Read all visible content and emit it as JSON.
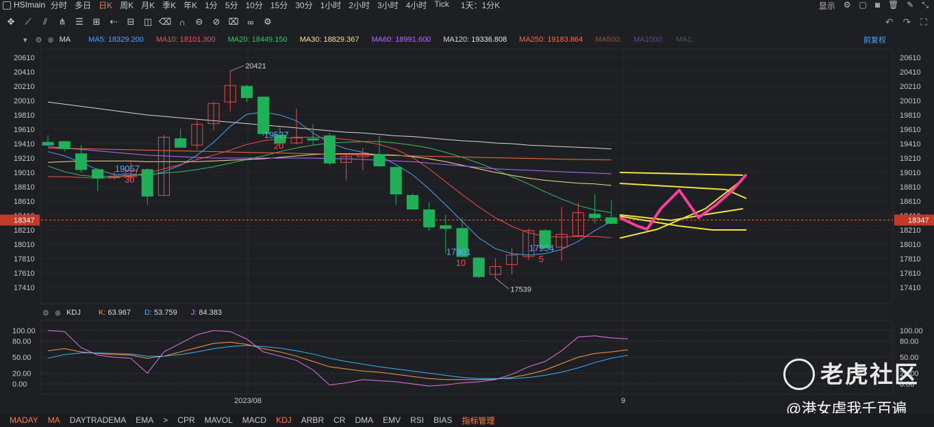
{
  "topbar": {
    "symbol": "HSImain",
    "timeframes": [
      {
        "label": "分时",
        "active": false
      },
      {
        "label": "多日",
        "active": false
      },
      {
        "label": "日K",
        "active": true
      },
      {
        "label": "周K",
        "active": false
      },
      {
        "label": "月K",
        "active": false
      },
      {
        "label": "季K",
        "active": false
      },
      {
        "label": "年K",
        "active": false
      },
      {
        "label": "1分",
        "active": false
      },
      {
        "label": "5分",
        "active": false
      },
      {
        "label": "10分",
        "active": false
      },
      {
        "label": "15分",
        "active": false
      },
      {
        "label": "30分",
        "active": false
      },
      {
        "label": "1小时",
        "active": false
      },
      {
        "label": "2小时",
        "active": false
      },
      {
        "label": "3小时",
        "active": false
      },
      {
        "label": "4小时",
        "active": false
      },
      {
        "label": "Tick",
        "active": false
      }
    ],
    "interval_select": "1天：1分K",
    "display_label": "显示"
  },
  "ma_row": {
    "indicator": "MA",
    "items": [
      {
        "label": "MA5:",
        "value": "18329.200",
        "color": "#4aa3ff"
      },
      {
        "label": "MA10:",
        "value": "18101.300",
        "color": "#ff4d4f"
      },
      {
        "label": "MA20:",
        "value": "18449.150",
        "color": "#3cbf6a"
      },
      {
        "label": "MA30:",
        "value": "18829.367",
        "color": "#f5e28a"
      },
      {
        "label": "MA60:",
        "value": "18991.600",
        "color": "#b070ff"
      },
      {
        "label": "MA120:",
        "value": "19336.808",
        "color": "#d9d9d9"
      },
      {
        "label": "MA250:",
        "value": "19183.864",
        "color": "#ff6a3d"
      },
      {
        "label": "MA500:",
        "value": "",
        "color": "#8a5a3a"
      },
      {
        "label": "MA1000:",
        "value": "",
        "color": "#5a4a8a"
      },
      {
        "label": "MA1:",
        "value": "",
        "color": "#555555"
      }
    ],
    "adjust_label": "前复权"
  },
  "kdj_row": {
    "indicator": "KDJ",
    "items": [
      {
        "label": "K:",
        "value": "63.967",
        "color": "#ff9a3c"
      },
      {
        "label": "D:",
        "value": "53.759",
        "color": "#38b6ff"
      },
      {
        "label": "J:",
        "value": "84.383",
        "color": "#e27ae6"
      }
    ]
  },
  "bottom_tabs": [
    {
      "label": "MADAY",
      "active": true
    },
    {
      "label": "MA",
      "active": true
    },
    {
      "label": "DAYTRADEMA",
      "active": false
    },
    {
      "label": "EMA",
      "active": false
    },
    {
      "label": ">",
      "active": false
    },
    {
      "label": "CPR",
      "active": false
    },
    {
      "label": "MAVOL",
      "active": false
    },
    {
      "label": "MACD",
      "active": false
    },
    {
      "label": "KDJ",
      "active": true
    },
    {
      "label": "ARBR",
      "active": false
    },
    {
      "label": "CR",
      "active": false
    },
    {
      "label": "DMA",
      "active": false
    },
    {
      "label": "EMV",
      "active": false
    },
    {
      "label": "RSI",
      "active": false
    },
    {
      "label": "BIAS",
      "active": false
    },
    {
      "label": "指标管理",
      "active": true
    }
  ],
  "watermark": {
    "brand": "老虎社区",
    "user": "@港女虐我千百遍"
  },
  "chart_data": {
    "type": "candlestick",
    "price_axis_ticks": [
      "20610",
      "20410",
      "20210",
      "20010",
      "19810",
      "19610",
      "19410",
      "19210",
      "19010",
      "18810",
      "18610",
      "18410",
      "18210",
      "18010",
      "17810",
      "17610",
      "17410"
    ],
    "last_price_label": "18347",
    "x_labels": [
      {
        "index": 12,
        "label": "2023/08"
      },
      {
        "index": 35,
        "label": "9"
      }
    ],
    "ohlc": [
      {
        "o": 19430,
        "h": 19530,
        "l": 19380,
        "c": 19390
      },
      {
        "o": 19440,
        "h": 19450,
        "l": 19300,
        "c": 19340
      },
      {
        "o": 19270,
        "h": 19390,
        "l": 19010,
        "c": 19050
      },
      {
        "o": 19050,
        "h": 19070,
        "l": 18750,
        "c": 18930
      },
      {
        "o": 18940,
        "h": 19020,
        "l": 18910,
        "c": 18950
      },
      {
        "o": 18950,
        "h": 19180,
        "l": 18900,
        "c": 19040
      },
      {
        "o": 19050,
        "h": 19070,
        "l": 18560,
        "c": 18680
      },
      {
        "o": 18690,
        "h": 19530,
        "l": 18680,
        "c": 19500
      },
      {
        "o": 19480,
        "h": 19620,
        "l": 19360,
        "c": 19360
      },
      {
        "o": 19390,
        "h": 19760,
        "l": 19330,
        "c": 19680
      },
      {
        "o": 19690,
        "h": 19990,
        "l": 19600,
        "c": 19970
      },
      {
        "o": 19990,
        "h": 20421,
        "l": 19860,
        "c": 20220
      },
      {
        "o": 20210,
        "h": 20230,
        "l": 19990,
        "c": 20050
      },
      {
        "o": 20060,
        "h": 20060,
        "l": 19520,
        "c": 19550
      },
      {
        "o": 19530,
        "h": 19640,
        "l": 19390,
        "c": 19420
      },
      {
        "o": 19420,
        "h": 19900,
        "l": 19400,
        "c": 19490
      },
      {
        "o": 19480,
        "h": 19680,
        "l": 19390,
        "c": 19460
      },
      {
        "o": 19520,
        "h": 19560,
        "l": 19110,
        "c": 19140
      },
      {
        "o": 19150,
        "h": 19260,
        "l": 18900,
        "c": 19230
      },
      {
        "o": 19230,
        "h": 19350,
        "l": 19040,
        "c": 19260
      },
      {
        "o": 19260,
        "h": 19520,
        "l": 19090,
        "c": 19100
      },
      {
        "o": 19080,
        "h": 19100,
        "l": 18560,
        "c": 18710
      },
      {
        "o": 18690,
        "h": 18720,
        "l": 18490,
        "c": 18500
      },
      {
        "o": 18490,
        "h": 18590,
        "l": 18200,
        "c": 18250
      },
      {
        "o": 18270,
        "h": 18420,
        "l": 17880,
        "c": 18230
      },
      {
        "o": 18230,
        "h": 18380,
        "l": 17830,
        "c": 17840
      },
      {
        "o": 17820,
        "h": 17830,
        "l": 17540,
        "c": 17560
      },
      {
        "o": 17590,
        "h": 17820,
        "l": 17539,
        "c": 17700
      },
      {
        "o": 17730,
        "h": 17960,
        "l": 17590,
        "c": 17860
      },
      {
        "o": 17840,
        "h": 18230,
        "l": 17790,
        "c": 18200
      },
      {
        "o": 18200,
        "h": 18220,
        "l": 17940,
        "c": 17960
      },
      {
        "o": 17970,
        "h": 18530,
        "l": 17780,
        "c": 18150
      },
      {
        "o": 18130,
        "h": 18590,
        "l": 18120,
        "c": 18450
      },
      {
        "o": 18430,
        "h": 18710,
        "l": 18300,
        "c": 18380
      },
      {
        "o": 18380,
        "h": 18620,
        "l": 18290,
        "c": 18300
      }
    ],
    "ma_lines": [
      {
        "name": "MA5",
        "color": "#4aa3ff",
        "values": [
          19300,
          19240,
          19150,
          19050,
          18980,
          18990,
          18960,
          19020,
          19110,
          19250,
          19430,
          19650,
          19820,
          19850,
          19810,
          19730,
          19560,
          19420,
          19340,
          19290,
          19240,
          19120,
          18980,
          18780,
          18560,
          18330,
          18100,
          17950,
          17880,
          17860,
          17880,
          17940,
          18050,
          18200,
          18329
        ]
      },
      {
        "name": "MA10",
        "color": "#ff4d4f",
        "values": [
          18950,
          18950,
          18940,
          18930,
          18940,
          18960,
          19000,
          19060,
          19120,
          19190,
          19250,
          19320,
          19400,
          19450,
          19480,
          19500,
          19500,
          19490,
          19470,
          19440,
          19400,
          19330,
          19220,
          19060,
          18880,
          18700,
          18530,
          18380,
          18260,
          18170,
          18120,
          18110,
          18120,
          18120,
          18101
        ]
      },
      {
        "name": "MA20",
        "color": "#3cbf6a",
        "values": [
          19100,
          19020,
          18970,
          18950,
          18960,
          18970,
          18980,
          19000,
          19020,
          19050,
          19090,
          19140,
          19190,
          19240,
          19300,
          19350,
          19390,
          19420,
          19430,
          19440,
          19440,
          19420,
          19390,
          19350,
          19290,
          19220,
          19140,
          19050,
          18950,
          18850,
          18740,
          18640,
          18550,
          18490,
          18449
        ]
      },
      {
        "name": "MA30",
        "color": "#f5e28a",
        "values": [
          19150,
          19160,
          19170,
          19170,
          19170,
          19170,
          19160,
          19160,
          19160,
          19160,
          19170,
          19180,
          19190,
          19200,
          19220,
          19240,
          19260,
          19270,
          19270,
          19270,
          19260,
          19250,
          19230,
          19200,
          19160,
          19110,
          19060,
          19010,
          18970,
          18930,
          18900,
          18880,
          18860,
          18850,
          18829
        ]
      },
      {
        "name": "MA60",
        "color": "#b070ff",
        "values": [
          19370,
          19350,
          19330,
          19310,
          19290,
          19270,
          19250,
          19240,
          19230,
          19220,
          19210,
          19210,
          19210,
          19210,
          19210,
          19210,
          19210,
          19200,
          19200,
          19190,
          19180,
          19170,
          19160,
          19140,
          19120,
          19100,
          19080,
          19060,
          19050,
          19040,
          19030,
          19020,
          19010,
          19000,
          18991
        ]
      },
      {
        "name": "MA120",
        "color": "#d9d9d9",
        "values": [
          19990,
          19960,
          19930,
          19900,
          19870,
          19840,
          19810,
          19790,
          19770,
          19750,
          19730,
          19710,
          19690,
          19670,
          19650,
          19630,
          19610,
          19590,
          19570,
          19560,
          19540,
          19520,
          19510,
          19490,
          19470,
          19450,
          19440,
          19420,
          19410,
          19390,
          19380,
          19370,
          19360,
          19350,
          19337
        ]
      },
      {
        "name": "MA250",
        "color": "#ff6a3d",
        "values": [
          19350,
          19345,
          19340,
          19335,
          19330,
          19325,
          19320,
          19315,
          19310,
          19305,
          19300,
          19295,
          19290,
          19285,
          19280,
          19275,
          19270,
          19265,
          19260,
          19255,
          19250,
          19245,
          19240,
          19235,
          19230,
          19225,
          19220,
          19215,
          19210,
          19205,
          19200,
          19195,
          19190,
          19187,
          19184
        ]
      }
    ],
    "annotations": [
      {
        "index": 11,
        "price": 20421,
        "text": "20421",
        "kind": "high"
      },
      {
        "index": 27,
        "price": 17539,
        "text": "17539",
        "kind": "low"
      },
      {
        "index": 13,
        "price": 19527,
        "text": "19527",
        "sub": "20",
        "kind": "ma"
      },
      {
        "index": 4,
        "price": 19057,
        "text": "19057",
        "sub": "30",
        "kind": "ma"
      },
      {
        "index": 24,
        "price": 17901,
        "text": "17901",
        "sub": "10",
        "kind": "ma"
      },
      {
        "index": 29,
        "price": 17954,
        "text": "17954",
        "sub": "5",
        "kind": "ma"
      }
    ],
    "kdj": {
      "axis_ticks": [
        "100.00",
        "80.00",
        "50.00",
        "20.00",
        "0.00"
      ],
      "K": [
        62,
        66,
        60,
        57,
        55,
        54,
        48,
        52,
        60,
        68,
        76,
        78,
        74,
        66,
        60,
        52,
        42,
        32,
        28,
        24,
        22,
        18,
        14,
        10,
        8,
        8,
        8,
        9,
        12,
        18,
        26,
        38,
        50,
        57,
        60,
        63.967
      ],
      "D": [
        48,
        55,
        58,
        58,
        57,
        56,
        52,
        52,
        55,
        60,
        66,
        70,
        72,
        70,
        67,
        62,
        56,
        48,
        42,
        37,
        32,
        28,
        24,
        20,
        16,
        12,
        10,
        10,
        10,
        12,
        16,
        22,
        30,
        40,
        48,
        53.759
      ],
      "J": [
        100,
        98,
        68,
        54,
        50,
        48,
        20,
        60,
        76,
        92,
        100,
        98,
        84,
        60,
        52,
        44,
        26,
        -2,
        2,
        8,
        6,
        4,
        0,
        -4,
        -2,
        2,
        4,
        8,
        18,
        32,
        42,
        62,
        88,
        90,
        86,
        84.383
      ]
    },
    "hand_drawn_note": "yellow projection lines and pink zigzag forecast drawn by user"
  }
}
